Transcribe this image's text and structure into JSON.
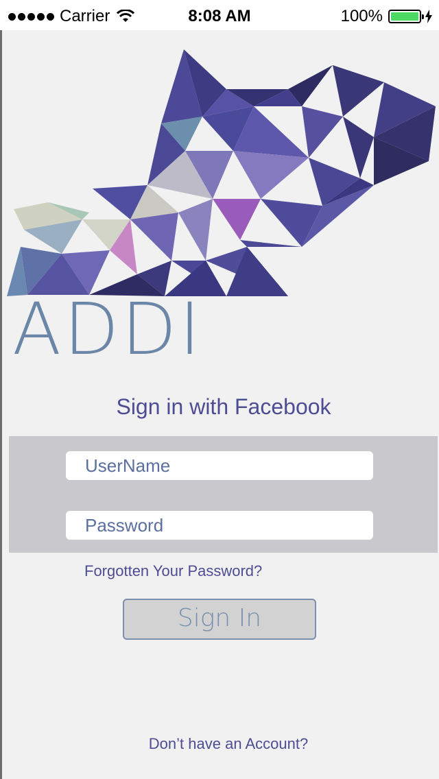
{
  "status_bar": {
    "carrier": "Carrier",
    "time": "8:08 AM",
    "battery_percent": "100%",
    "battery_level": 1.0
  },
  "logo": {
    "text": "ADDI"
  },
  "facebook": {
    "label": "Sign in with Facebook"
  },
  "form": {
    "username_placeholder": "UserName",
    "password_placeholder": "Password"
  },
  "forgot_password": "Forgotten Your Password?",
  "sign_in_button": "Sign In",
  "no_account": "Don’t have an Account?",
  "colors": {
    "accent": "#4e4c93",
    "logo": "#6b86a6",
    "panel": "#c9c8cc",
    "background": "#f1f1f1"
  }
}
